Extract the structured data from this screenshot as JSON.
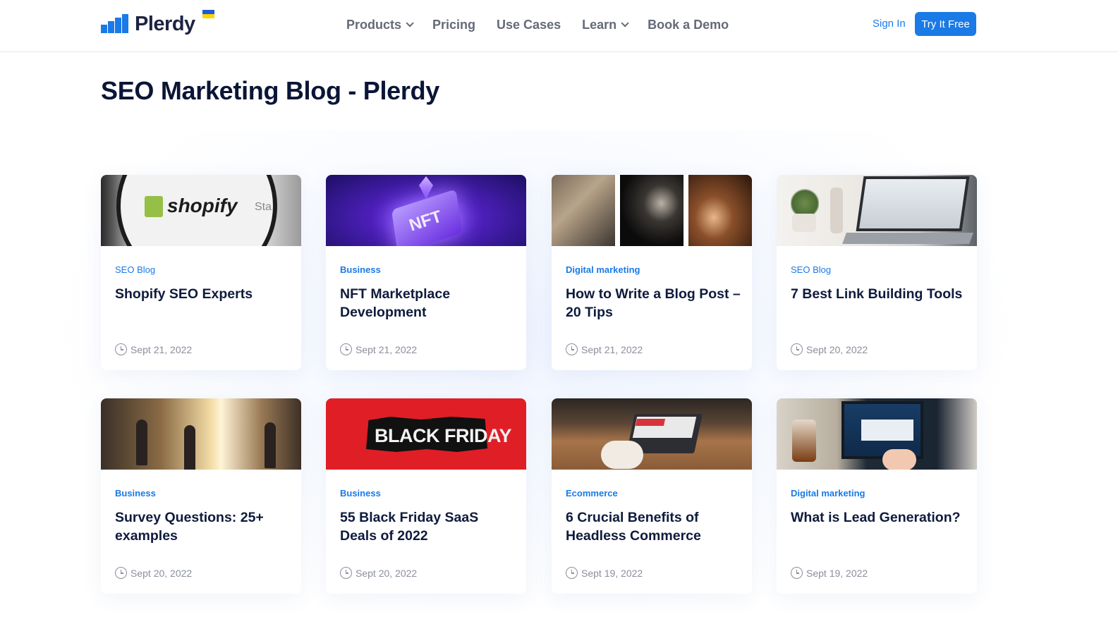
{
  "brand": {
    "logo_text": "Plerdy",
    "flag_colors": [
      "#1e5bd6",
      "#ffd500"
    ]
  },
  "nav": {
    "items": [
      {
        "label": "Products",
        "dropdown": true
      },
      {
        "label": "Pricing",
        "dropdown": false
      },
      {
        "label": "Use Cases",
        "dropdown": false
      },
      {
        "label": "Learn",
        "dropdown": true
      },
      {
        "label": "Book a Demo",
        "dropdown": false
      }
    ],
    "sign_in": "Sign In",
    "try_free": "Try It Free"
  },
  "colors": {
    "accent": "#1a7ae6",
    "title": "#0b1536",
    "muted": "#8a8f9c"
  },
  "page": {
    "title": "SEO Marketing Blog - Plerdy"
  },
  "posts": [
    {
      "category": "SEO Blog",
      "title": "Shopify SEO Experts",
      "date": "Sept 21, 2022",
      "thumb_text": "shopify",
      "thumb_text2": "Sta"
    },
    {
      "category": "Business",
      "title": "NFT Marketplace Development",
      "date": "Sept 21, 2022",
      "thumb_text": "NFT"
    },
    {
      "category": "Digital marketing",
      "title": "How to Write a Blog Post – 20 Tips",
      "date": "Sept 21, 2022"
    },
    {
      "category": "SEO Blog",
      "title": "7 Best Link Building Tools",
      "date": "Sept 20, 2022"
    },
    {
      "category": "Business",
      "title": "Survey Questions: 25+ examples",
      "date": "Sept 20, 2022"
    },
    {
      "category": "Business",
      "title": "55 Black Friday SaaS Deals of 2022",
      "date": "Sept 20, 2022",
      "thumb_text": "BLACK FRIDAY"
    },
    {
      "category": "Ecommerce",
      "title": "6 Crucial Benefits of Headless Commerce",
      "date": "Sept 19, 2022"
    },
    {
      "category": "Digital marketing",
      "title": "What is Lead Generation?",
      "date": "Sept 19, 2022"
    }
  ]
}
